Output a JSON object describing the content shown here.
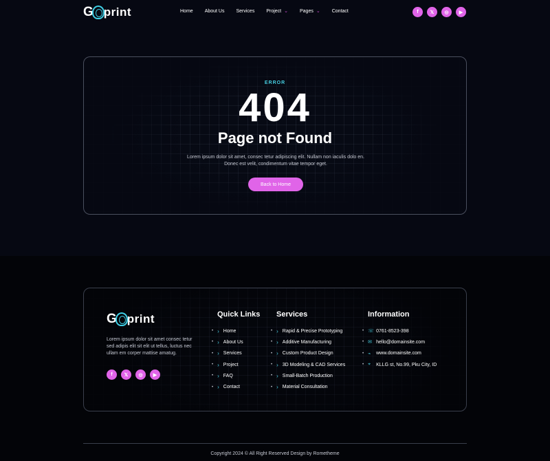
{
  "header": {
    "logo_g": "G",
    "logo_word": "print",
    "nav": [
      {
        "label": "Home",
        "dropdown": false
      },
      {
        "label": "About Us",
        "dropdown": false
      },
      {
        "label": "Services",
        "dropdown": false
      },
      {
        "label": "Project",
        "dropdown": true
      },
      {
        "label": "Pages",
        "dropdown": true
      },
      {
        "label": "Contact",
        "dropdown": false
      }
    ],
    "socials": [
      "facebook-icon",
      "x-icon",
      "instagram-icon",
      "youtube-icon"
    ]
  },
  "hero": {
    "label": "ERROR",
    "code": "404",
    "title": "Page not Found",
    "text_line1": "Lorem ipsum dolor sit amet, consec tetur adipiscing elit. Nullam non iaculis dolo en.",
    "text_line2": "Donec est velit, condimentum vitae tempor eget.",
    "button": "Back to Home"
  },
  "footer": {
    "about": "Lorem ipsum dolor sit amet consec tetur sed adipis elit sit elit ut tellus, luctus nec ullam em corper mattise amatug.",
    "quick_links_title": "Quick Links",
    "quick_links": [
      "Home",
      "About Us",
      "Services",
      "Project",
      "FAQ",
      "Contact"
    ],
    "services_title": "Services",
    "services": [
      "Rapid & Precise Prototyping",
      "Additive Manufacturing",
      "Custom Product Design",
      "3D Modeling & CAD Services",
      "Small-Batch Production",
      "Material Consultation"
    ],
    "info_title": "Information",
    "info": [
      {
        "icon": "phone-icon",
        "text": "0761-8523-398"
      },
      {
        "icon": "email-icon",
        "text": "hello@domainsite.com"
      },
      {
        "icon": "globe-icon",
        "text": "www.domainsite.com"
      },
      {
        "icon": "location-icon",
        "text": "KLLG st, No.99, Pku City, ID"
      }
    ],
    "copyright": "Copyright 2024 © All Right Reserved Design by Rometheme"
  },
  "colors": {
    "accent_pink": "#e064e8",
    "accent_cyan": "#46cde0",
    "background": "#060812"
  }
}
